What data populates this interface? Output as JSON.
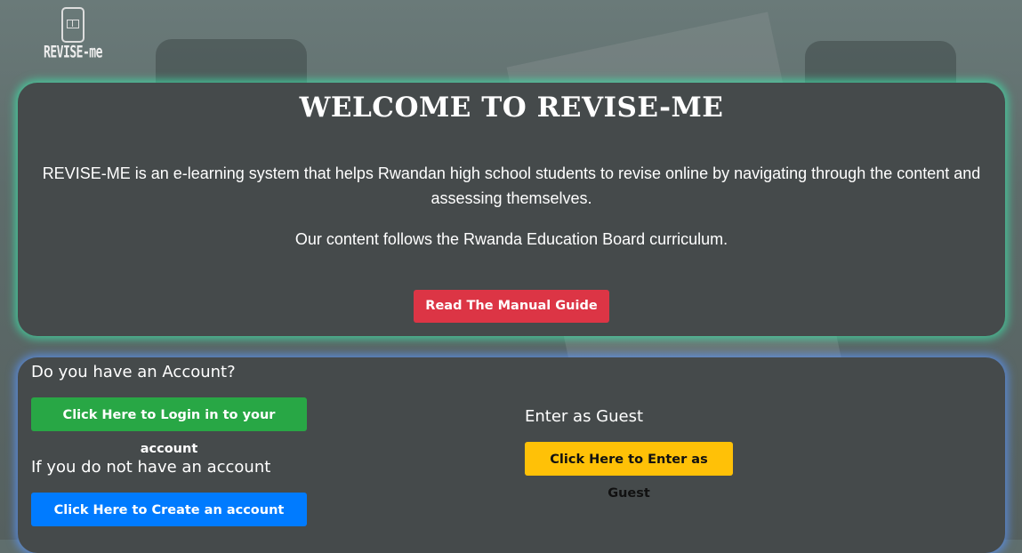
{
  "logo": {
    "text": "REVISE-me",
    "icon": "phone-book-icon"
  },
  "welcome": {
    "title": "WELCOME TO REVISE-ME",
    "paragraph1": "REVISE-ME is an e-learning system that helps Rwandan high school students to revise online by navigating through the content and assessing themselves.",
    "paragraph2": "Our content follows the Rwanda Education Board curriculum.",
    "manual_button": "Read The Manual Guide"
  },
  "account": {
    "have_account_label": "Do you have an Account?",
    "login_button": "Click Here to Login in to your account",
    "no_account_label": "If you do not have an account",
    "create_button": "Click Here to Create an account",
    "guest_label": "Enter as Guest",
    "guest_button": "Click Here to Enter as Guest"
  },
  "colors": {
    "panel": "#454a4b",
    "welcome_glow": "#3ce6aa",
    "account_glow": "#5a96ff",
    "danger": "#dc3545",
    "success": "#28a745",
    "primary": "#007bff",
    "warning": "#ffc107"
  }
}
